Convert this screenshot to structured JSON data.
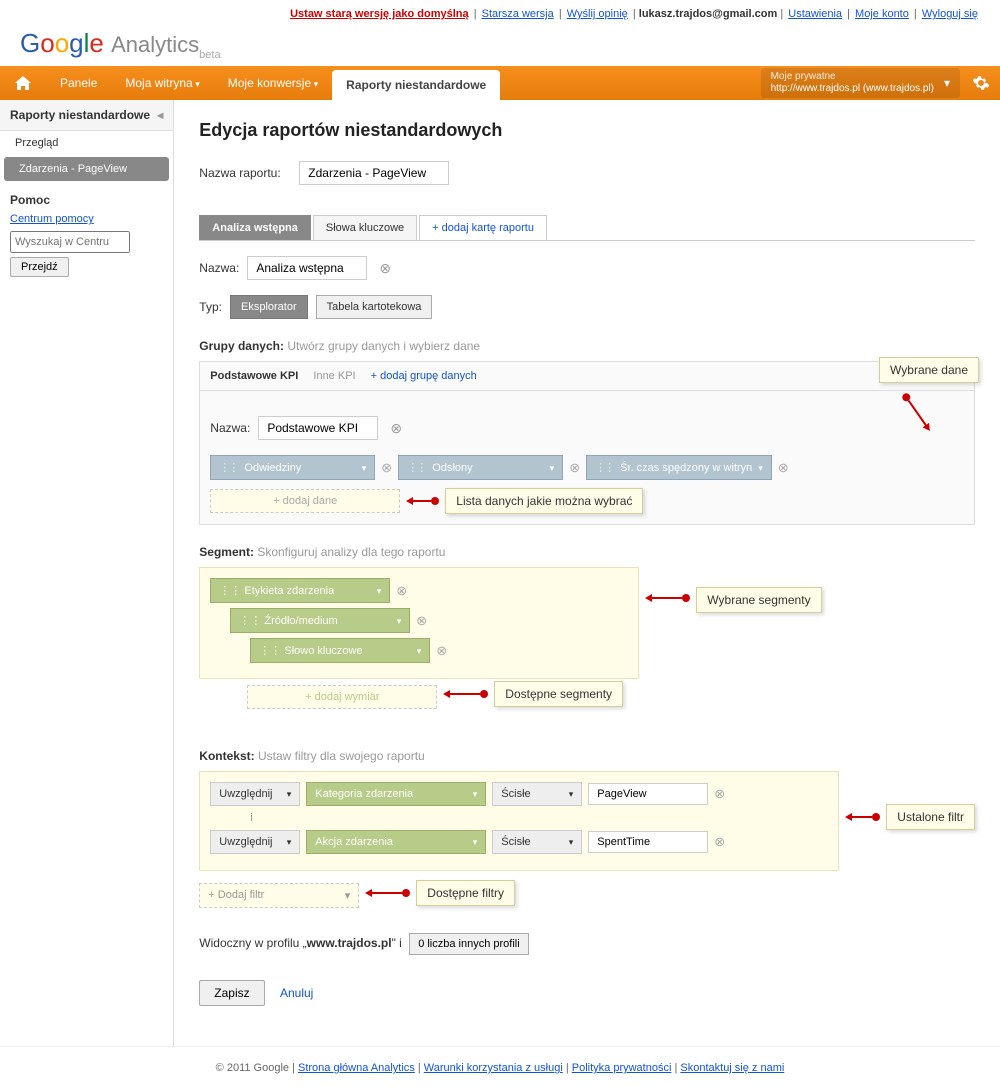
{
  "top_links": {
    "set_old": "Ustaw starą wersję jako domyślną",
    "old_ver": "Starsza wersja",
    "feedback": "Wyślij opinię",
    "email": "lukasz.trajdos@gmail.com",
    "settings": "Ustawienia",
    "account": "Moje konto",
    "logout": "Wyloguj się"
  },
  "logo": {
    "analytics": "Analytics",
    "beta": "beta"
  },
  "nav": {
    "panele": "Panele",
    "witryna": "Moja witryna",
    "konwersje": "Moje konwersje",
    "raporty": "Raporty niestandardowe",
    "site_lbl": "Moje prywatne",
    "site_url": "http://www.trajdos.pl (www.trajdos.pl)"
  },
  "sidebar": {
    "head": "Raporty niestandardowe",
    "overview": "Przegląd",
    "selected": "Zdarzenia - PageView",
    "help": "Pomoc",
    "help_link": "Centrum pomocy",
    "search_ph": "Wyszukaj w Centru",
    "go": "Przejdź"
  },
  "page": {
    "title": "Edycja raportów niestandardowych",
    "name_lbl": "Nazwa raportu:",
    "name_val": "Zdarzenia - PageView"
  },
  "tabs": {
    "t1": "Analiza wstępna",
    "t2": "Słowa kluczowe",
    "add": "+ dodaj kartę raportu"
  },
  "tabform": {
    "name_lbl": "Nazwa:",
    "name_val": "Analiza wstępna",
    "type_lbl": "Typ:",
    "type1": "Eksplorator",
    "type2": "Tabela kartotekowa"
  },
  "groups": {
    "head": "Grupy danych:",
    "hint": "Utwórz grupy danych i wybierz dane",
    "tab1": "Podstawowe KPI",
    "tab2": "Inne KPI",
    "add": "+ dodaj grupę danych",
    "name_lbl": "Nazwa:",
    "name_val": "Podstawowe KPI",
    "m1": "Odwiedziny",
    "m2": "Odsłony",
    "m3": "Śr. czas spędzony w witryn",
    "add_metric": "+ dodaj dane"
  },
  "callouts": {
    "wybrane_dane": "Wybrane dane",
    "lista_danych": "Lista danych jakie można wybrać",
    "wybrane_seg": "Wybrane segmenty",
    "dostepne_seg": "Dostępne segmenty",
    "ustalone_filtr": "Ustalone filtr",
    "dostepne_filtry": "Dostępne filtry"
  },
  "segment": {
    "head": "Segment:",
    "hint": "Skonfiguruj analizy dla tego raportu",
    "s1": "Etykieta zdarzenia",
    "s2": "Źródło/medium",
    "s3": "Słowo kluczowe",
    "add": "+ dodaj wymiar"
  },
  "context": {
    "head": "Kontekst:",
    "hint": "Ustaw filtry dla swojego raportu",
    "include": "Uwzględnij",
    "and": "i",
    "dim1": "Kategoria zdarzenia",
    "dim2": "Akcja zdarzenia",
    "match": "Ścisłe",
    "v1": "PageView",
    "v2": "SpentTime",
    "add": "+ Dodaj filtr"
  },
  "visibility": {
    "pre": "Widoczny w profilu „",
    "site": "www.trajdos.pl",
    "post": "\" i",
    "btn": "0 liczba innych profili"
  },
  "actions": {
    "save": "Zapisz",
    "cancel": "Anuluj"
  },
  "footer": {
    "copy": "© 2011 Google",
    "l1": "Strona główna Analytics",
    "l2": "Warunki korzystania z usługi",
    "l3": "Polityka prywatności",
    "l4": "Skontaktuj się z nami"
  }
}
